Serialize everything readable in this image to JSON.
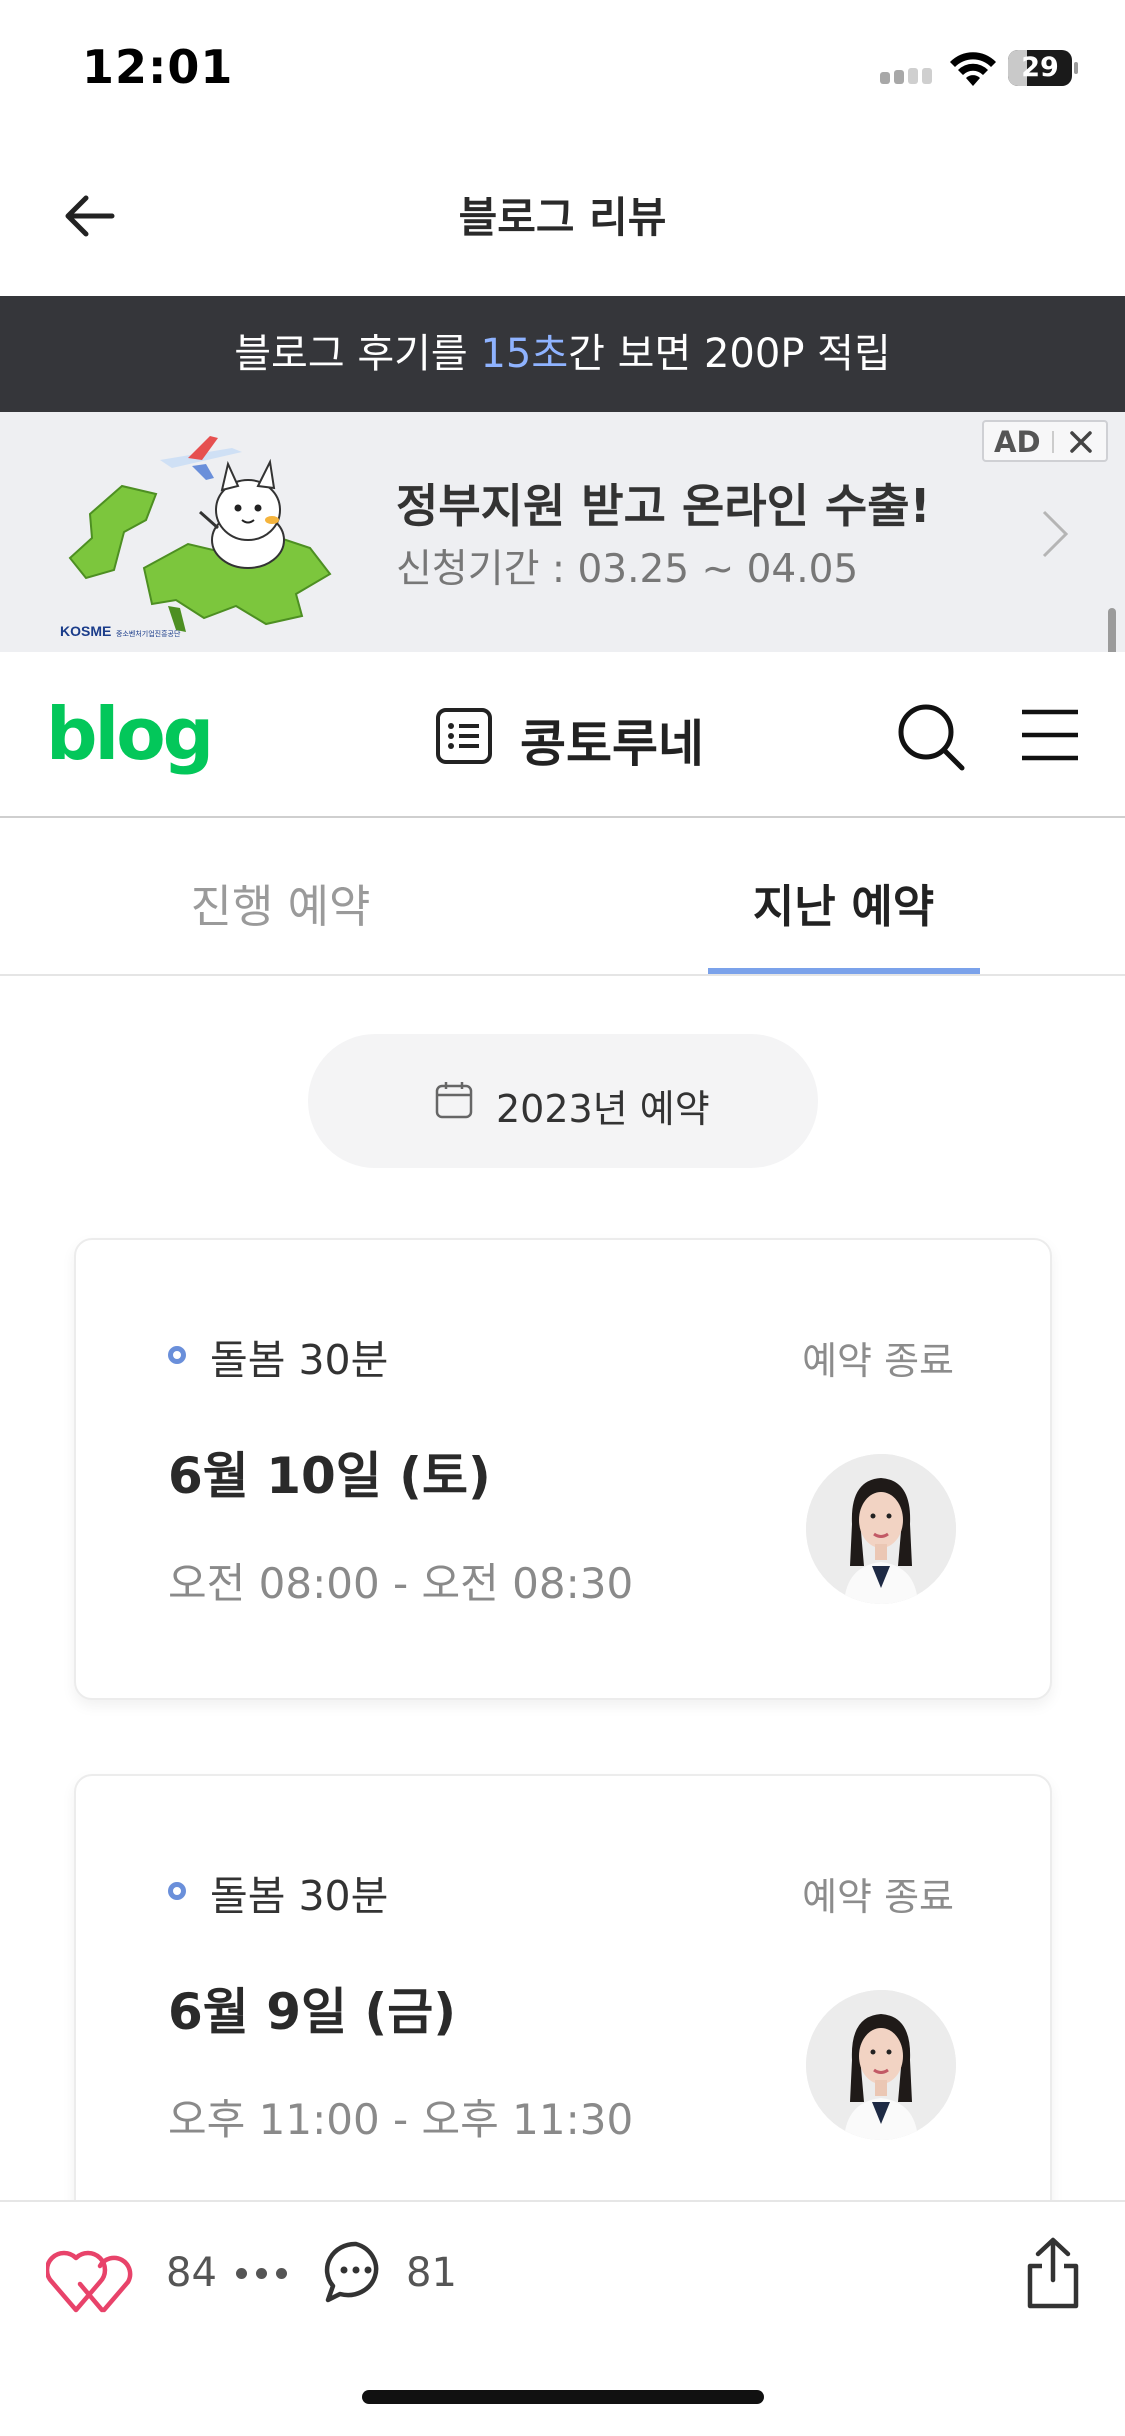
{
  "status_bar": {
    "time": "12:01",
    "battery_level": "29"
  },
  "header": {
    "title": "블로그 리뷰",
    "back_icon": "arrow-left-icon"
  },
  "promo": {
    "before": "블로그 후기를 ",
    "highlight": "15초",
    "after": "간 보면 200P 적립",
    "highlight_color": "#8fb3ff"
  },
  "ad": {
    "label": "AD",
    "title": "정부지원 받고 온라인 수출!",
    "subtitle": "신청기간 : 03.25 ~ 04.05",
    "brand": "KOSME",
    "brand_sub": "중소벤처기업진흥공단"
  },
  "blog": {
    "logo": "blog",
    "name": "콩토루네",
    "logo_color": "#03c75a"
  },
  "tabs": [
    {
      "label": "진행 예약",
      "active": false
    },
    {
      "label": "지난 예약",
      "active": true
    }
  ],
  "year_filter": {
    "label": "2023년 예약"
  },
  "reservations": [
    {
      "service": "돌봄 30분",
      "status": "예약 종료",
      "date": "6월 10일 (토)",
      "time": "오전 08:00 - 오전 08:30"
    },
    {
      "service": "돌봄 30분",
      "status": "예약 종료",
      "date": "6월 9일 (금)",
      "time": "오후 11:00 - 오후 11:30"
    }
  ],
  "bottom_bar": {
    "likes": "84",
    "comments": "81"
  },
  "colors": {
    "accent": "#7ba2ea",
    "dark_bar": "#35363a",
    "like": "#e8436a"
  }
}
